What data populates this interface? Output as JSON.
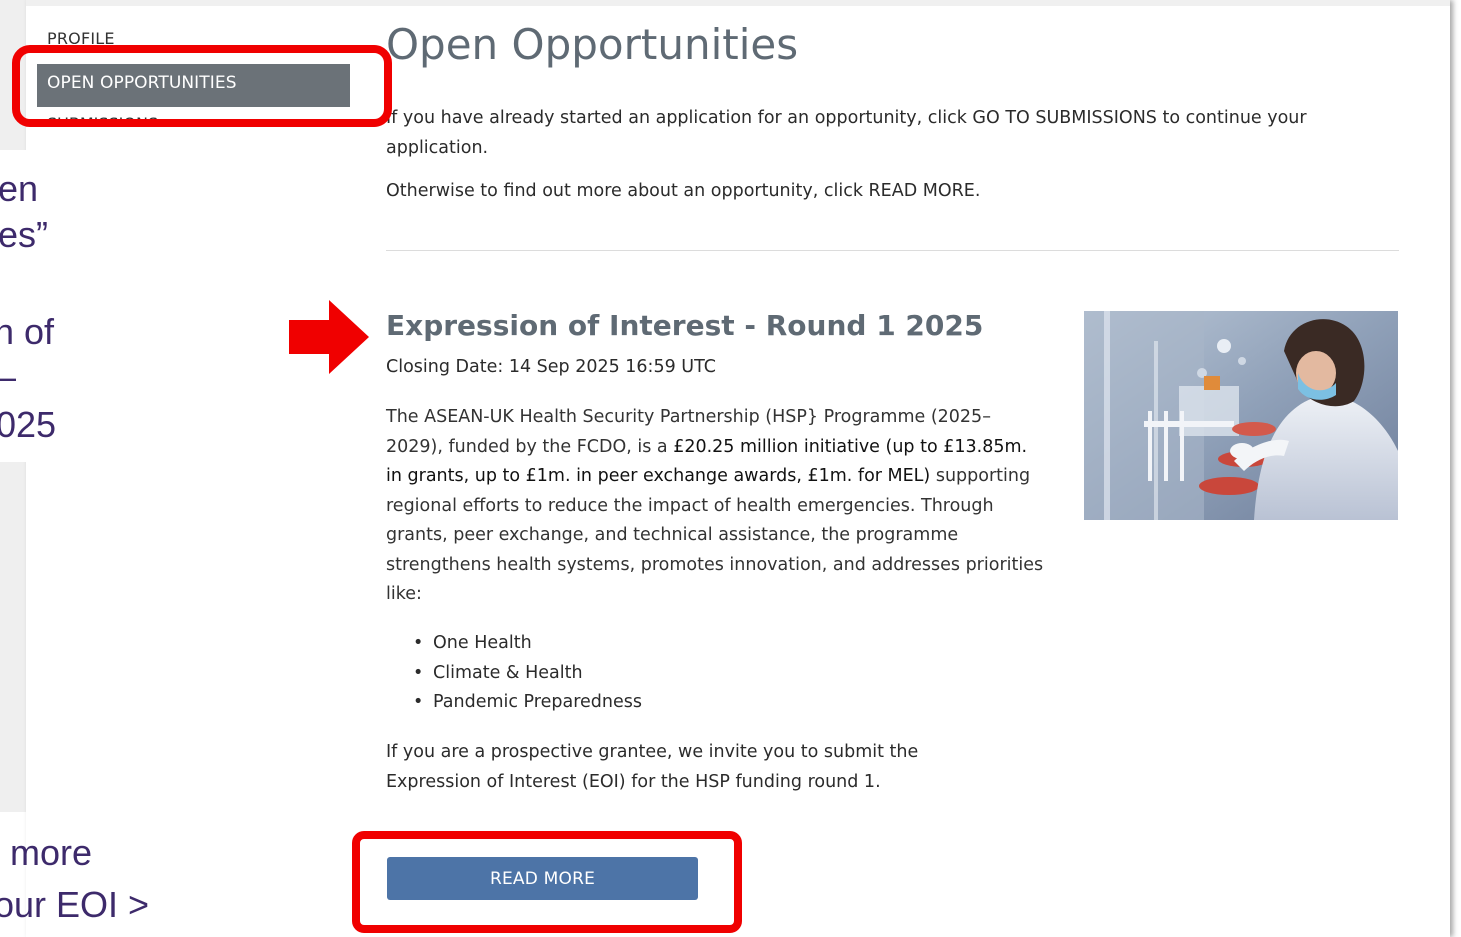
{
  "sidebar": {
    "items": [
      {
        "label": "PROFILE",
        "active": false
      },
      {
        "label": "OPEN OPPORTUNITIES",
        "active": true
      },
      {
        "label": "SUBMISSIONS",
        "active": false
      }
    ]
  },
  "overlay": {
    "lines": [
      "en",
      "es”",
      "n of",
      "–",
      "025",
      "more",
      "our EOI >"
    ]
  },
  "main": {
    "title": "Open Opportunities",
    "intro_paragraph_1": "If you have already started an application for an opportunity, click GO TO SUBMISSIONS to continue your application.",
    "intro_paragraph_2": "Otherwise to find out more about an opportunity, click READ MORE."
  },
  "opportunity": {
    "title": "Expression of Interest - Round 1 2025",
    "closing_date": "Closing Date: 14 Sep 2025 16:59 UTC",
    "description_start": "The ASEAN-UK Health Security Partnership (HSP} Programme (2025–2029), funded by the FCDO, is a ",
    "description_bold": "£20.25 million initiative (up to £13.85m. in grants, up to £1m. in peer exchange awards, £1m. for MEL)",
    "description_end": " supporting regional efforts to reduce the impact of health emergencies. Through grants, peer exchange, and technical assistance, the programme strengthens health systems, promotes innovation, and addresses priorities like:",
    "priorities": [
      "One Health",
      "Climate & Health",
      "Pandemic Preparedness"
    ],
    "invite": "If you are a prospective grantee, we invite you to submit the Expression of Interest (EOI) for the HSP funding round 1.",
    "read_more_label": "READ MORE"
  },
  "colors": {
    "accent_button": "#4d74a7",
    "nav_active_bg": "#6b7278",
    "highlight_ring": "#f00000",
    "heading": "#5f6a74",
    "overlay_text": "#3d2a6b"
  }
}
